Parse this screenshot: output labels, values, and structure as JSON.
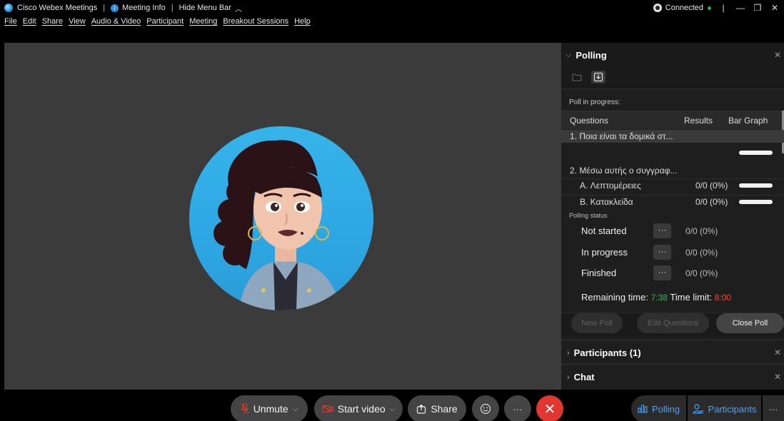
{
  "titlebar": {
    "app_name": "Cisco Webex Meetings",
    "meeting_info": "Meeting Info",
    "hide_menu_bar": "Hide Menu Bar",
    "status": "Connected"
  },
  "menu": [
    "File",
    "Edit",
    "Share",
    "View",
    "Audio & Video",
    "Participant",
    "Meeting",
    "Breakout Sessions",
    "Help"
  ],
  "polling": {
    "title": "Polling",
    "progress_label": "Poll in progress:",
    "columns": {
      "questions": "Questions",
      "results": "Results",
      "bar_graph": "Bar Graph"
    },
    "question1": "1. Ποια είναι τα δομικά στ...",
    "question2": "2. Μέσω αυτής ο συγγραφ...",
    "answers": [
      {
        "label": "A. Λεπτομέρειες",
        "value": "0/0 (0%)"
      },
      {
        "label": "B. Κατακλείδα",
        "value": "0/0 (0%)"
      }
    ],
    "status_label": "Polling status",
    "statuses": [
      {
        "name": "Not started",
        "value": "0/0 (0%)"
      },
      {
        "name": "In progress",
        "value": "0/0 (0%)"
      },
      {
        "name": "Finished",
        "value": "0/0 (0%)"
      }
    ],
    "remaining_label": "Remaining time:",
    "remaining_value": "7:38",
    "limit_label": "Time limit:",
    "limit_value": "8:00",
    "buttons": {
      "new_poll": "New Poll",
      "edit_questions": "Edit Questions",
      "close_poll": "Close Poll"
    }
  },
  "sections": {
    "participants": "Participants (1)",
    "chat": "Chat"
  },
  "controls": {
    "unmute": "Unmute",
    "start_video": "Start video",
    "share": "Share",
    "polling": "Polling",
    "participants": "Participants"
  },
  "colors": {
    "accent_blue": "#4aa3ff",
    "green": "#2fbf53",
    "red": "#f24b2f",
    "end_red": "#e13730"
  }
}
